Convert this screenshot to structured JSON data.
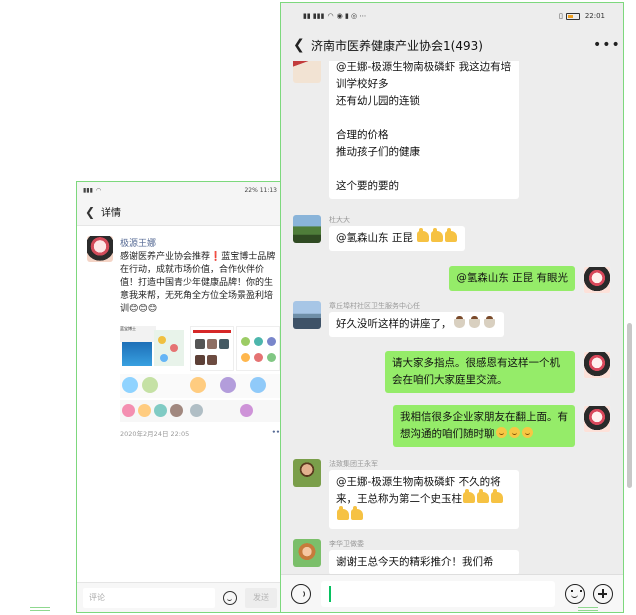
{
  "left_phone": {
    "status_left": "′ ′ ",
    "status_right": "22% 11:13",
    "title": "详情",
    "post": {
      "author": "极源王娜",
      "text": "感谢医养产业协会推荐❗蓝宝博士品牌在行动，成就市场价值，合作伙伴价值！打造中国青少年健康品牌！你的生意我来帮，无死角全方位全场景盈利培训😊😊😊",
      "poster_title": "蓝宝博士",
      "slide_title": "e5分钟学员刷跑练",
      "time": "2020年2月24日 22:05",
      "more": "••"
    },
    "comment_placeholder": "评论",
    "send_label": "发送"
  },
  "right_phone": {
    "time": "22:01",
    "title": "济南市医养健康产业协会1(493)",
    "menu": "•••",
    "messages": [
      {
        "sender": "",
        "text": "@王娜-极源生物南极磷虾  我这边有培训学校好多\n还有幼儿园的连锁\n\n合理的价格\n推动孩子们的健康\n\n这个要的要的"
      },
      {
        "sender": "杜大大",
        "text": "@氢森山东 正昆"
      },
      {
        "sender": "",
        "text": "@氢森山东 正昆  有眼光"
      },
      {
        "sender": "章丘埠村社区卫生服务中心任",
        "text": "好久没听这样的讲座了，"
      },
      {
        "sender": "",
        "text": "请大家多指点。很感恩有这样一个机会在咱们大家庭里交流。"
      },
      {
        "sender": "",
        "text": "我相信很多企业家朋友在翻上面。有想沟通的咱们随时聊"
      },
      {
        "sender": "法致集团王永军",
        "text": "@王娜-极源生物南极磷虾  不久的将来，王总称为第二个史玉柱"
      },
      {
        "sender": "李华卫做委",
        "text": "谢谢王总今天的精彩推介！我们希"
      }
    ]
  },
  "colors": {
    "bubble_green": "#95ec69",
    "accent_green": "#07c160",
    "link_blue": "#576b95",
    "frame_green": "#7dd87d"
  },
  "icons": [
    "back-icon",
    "more-icon",
    "voice-icon",
    "emoji-icon",
    "plus-icon",
    "battery-icon",
    "signal-icon"
  ]
}
